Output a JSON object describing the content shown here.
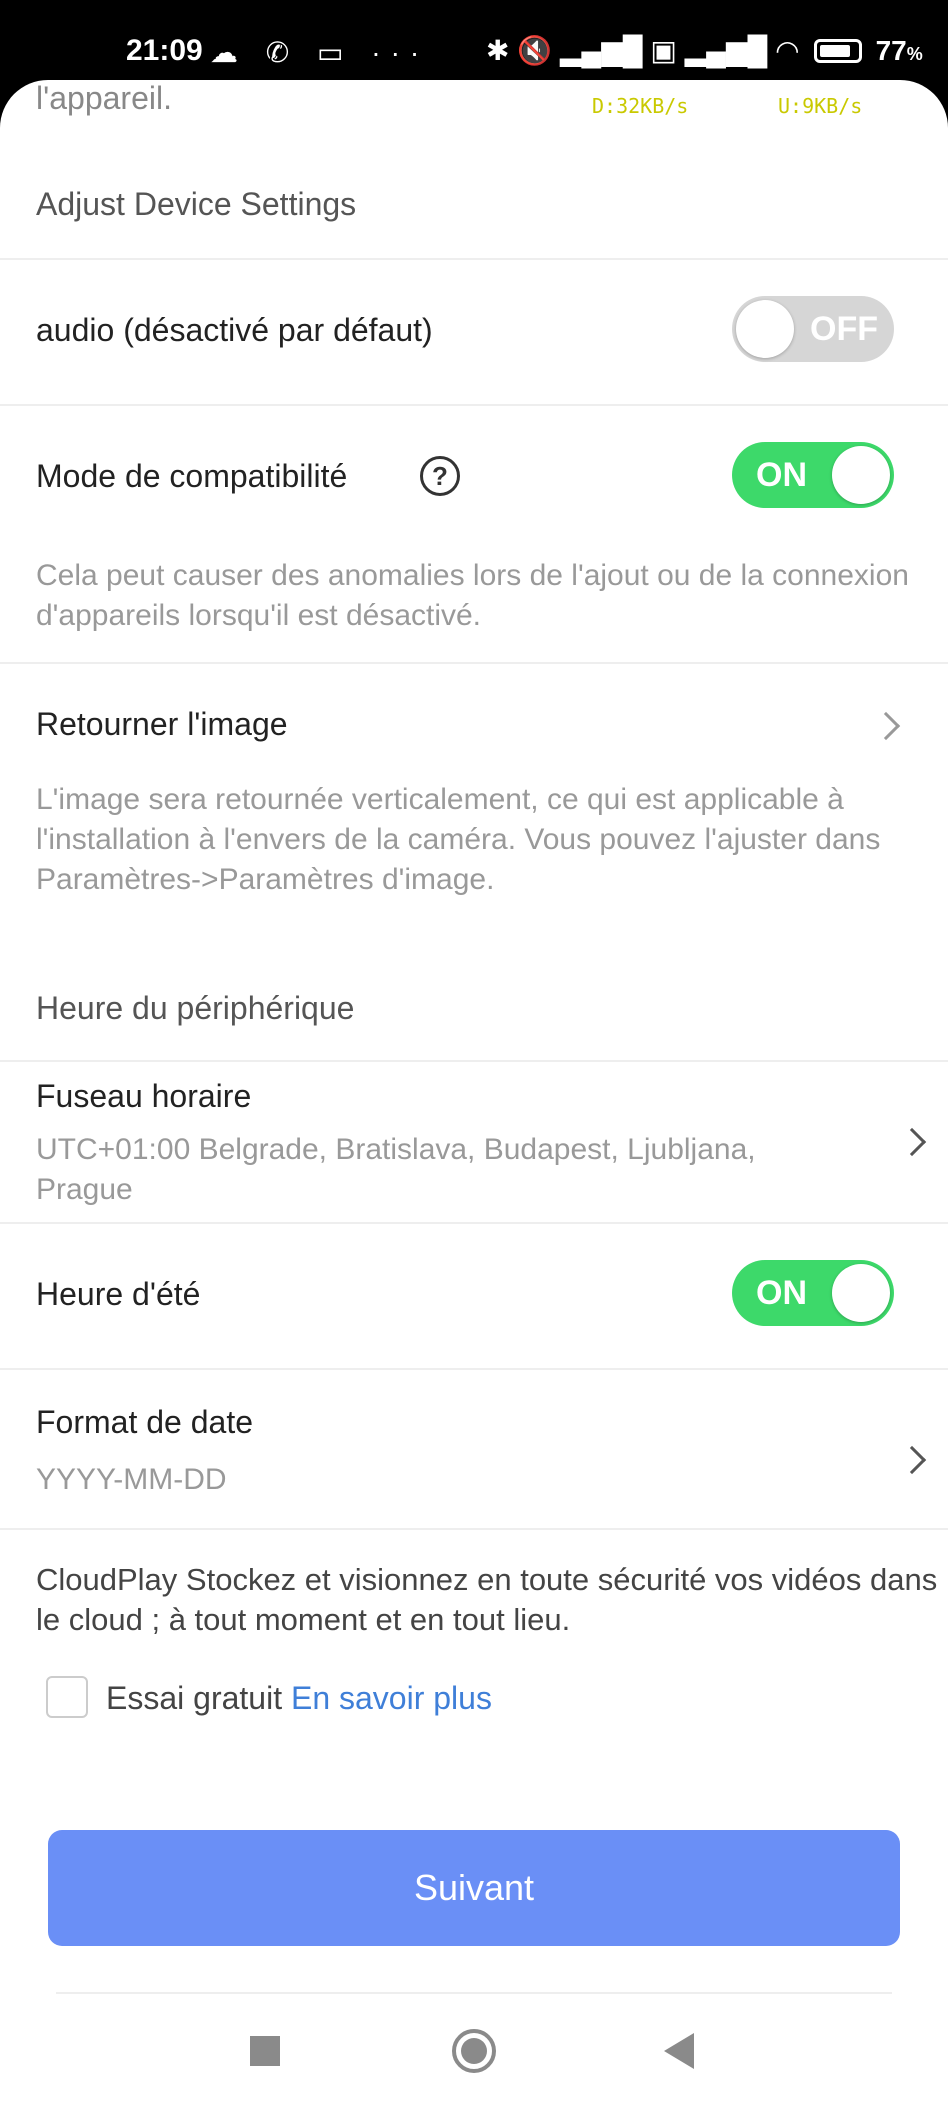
{
  "status_bar": {
    "time": "21:09",
    "left_icons": "☁ ✆ ▭ ···",
    "right_icons": [
      "bluetooth-icon",
      "mute-icon",
      "signal-icon",
      "volte-icon",
      "signal-icon",
      "wifi-icon"
    ],
    "right_glyphs": "✱ 🔇 ▂▄▆█ ▣ ▂▄▆█ ◠",
    "battery": "77",
    "battery_unit": "%"
  },
  "header": {
    "prev_text": "l'appareil.",
    "download_speed": "D:32KB/s",
    "upload_speed": "U:9KB/s"
  },
  "adjust_section": {
    "title": "Adjust Device Settings"
  },
  "audio": {
    "label": "audio (désactivé par défaut)",
    "toggle_text": "OFF"
  },
  "compat": {
    "label": "Mode de compatibilité",
    "help": "?",
    "toggle_text": "ON",
    "description": "Cela peut causer des anomalies lors de l'ajout ou de la connexion d'appareils lorsqu'il est désactivé."
  },
  "flip": {
    "label": "Retourner l'image",
    "description": "L'image sera retournée verticalement, ce qui est applicable à l'installation à l'envers de la caméra. Vous pouvez l'ajuster dans Paramètres->Paramètres d'image."
  },
  "time_section": {
    "title": "Heure du périphérique"
  },
  "timezone": {
    "label": "Fuseau horaire",
    "value": "UTC+01:00 Belgrade, Bratislava, Budapest, Ljubljana, Prague"
  },
  "dst": {
    "label": "Heure d'été",
    "toggle_text": "ON"
  },
  "date_format": {
    "label": "Format de date",
    "value": "YYYY-MM-DD"
  },
  "cloud": {
    "description": "CloudPlay Stockez et visionnez en toute sécurité vos vidéos dans le cloud ; à tout moment et en tout lieu.",
    "trial_label": "Essai gratuit",
    "learn_more": "En savoir plus"
  },
  "actions": {
    "next_label": "Suivant"
  },
  "colors": {
    "toggle_on": "#3dd96a",
    "toggle_off": "#d6d6d6",
    "primary_button": "#6a8ff6",
    "link": "#3f7fd8"
  }
}
